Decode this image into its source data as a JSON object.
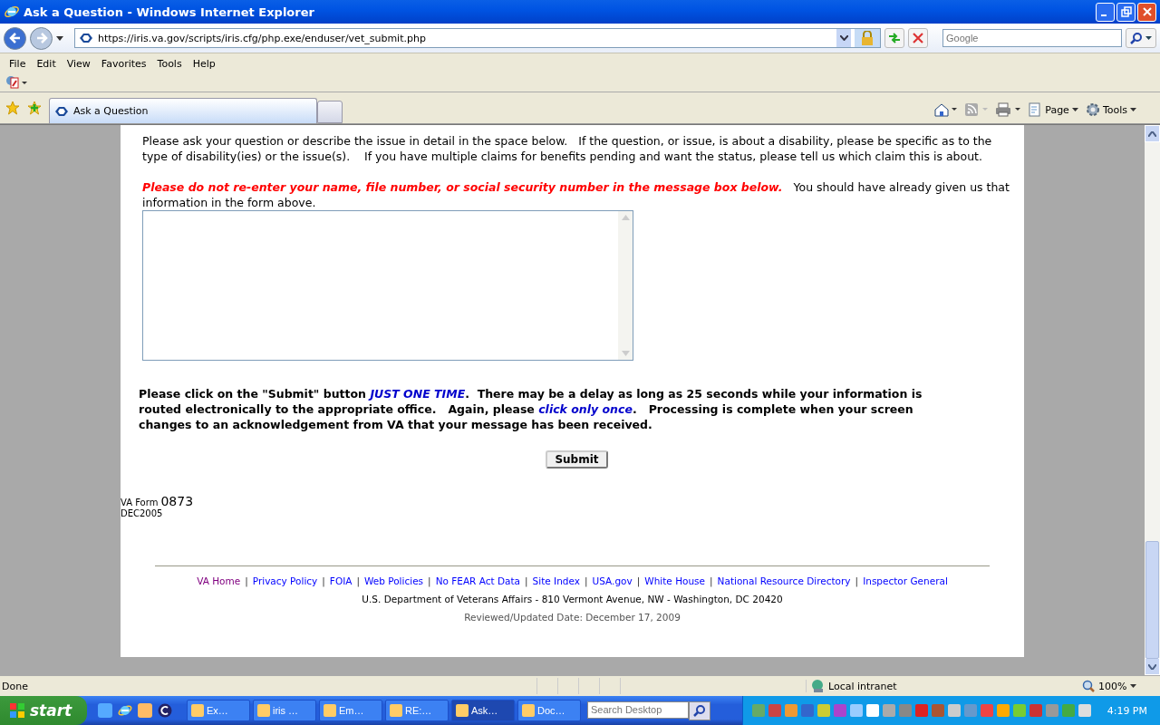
{
  "window": {
    "title": "Ask a Question - Windows Internet Explorer"
  },
  "address_bar": {
    "url": "https://iris.va.gov/scripts/iris.cfg/php.exe/enduser/vet_submit.php"
  },
  "search": {
    "placeholder": "Google"
  },
  "menu": [
    "File",
    "Edit",
    "View",
    "Favorites",
    "Tools",
    "Help"
  ],
  "tabs": [
    {
      "label": "Ask a Question",
      "selected": true
    }
  ],
  "command_bar": {
    "page": "Page",
    "tools": "Tools"
  },
  "page": {
    "intro": "Please ask your question or describe the issue in detail in the space below.   If the question, or issue, is about a disability, please be specific as to the type of disability(ies) or the issue(s).    If you have multiple claims for benefits pending and want the status, please tell us which claim this is about.",
    "warning": "*Please do not re-enter your name, file number, or social security number in the message box below.*   You should have already given us that information in the form above.",
    "notice": "Please click on the \"Submit\" button *JUST ONE TIME*.  There may be a delay as long as 25 seconds while your information is routed electronically to the appropriate office.   Again, please *click only once*.   Processing is complete when your screen changes to an acknowledgement from VA that your message has been received.",
    "submit": "Submit",
    "form_label": "VA Form",
    "form_number": "0873",
    "form_date": "DEC2005",
    "footer_links": [
      {
        "label": "VA Home",
        "visited": true
      },
      {
        "label": "Privacy Policy",
        "visited": false
      },
      {
        "label": "FOIA",
        "visited": false
      },
      {
        "label": "Web Policies",
        "visited": false
      },
      {
        "label": "No FEAR Act Data",
        "visited": false
      },
      {
        "label": "Site Index",
        "visited": false
      },
      {
        "label": "USA.gov",
        "visited": false
      },
      {
        "label": "White House",
        "visited": false
      },
      {
        "label": "National Resource Directory",
        "visited": false
      },
      {
        "label": "Inspector General",
        "visited": false
      }
    ],
    "separator": "|",
    "address": "U.S. Department of Veterans Affairs - 810 Vermont Avenue, NW - Washington, DC 20420",
    "updated": "Reviewed/Updated Date: December 17, 2009"
  },
  "status_bar": {
    "text": "Done",
    "zone": "Local intranet",
    "zoom": "100%"
  },
  "taskbar": {
    "start": "start",
    "buttons": [
      {
        "label": "Ex…",
        "selected": false
      },
      {
        "label": "iris …",
        "selected": false
      },
      {
        "label": "Em…",
        "selected": false
      },
      {
        "label": "RE:…",
        "selected": false
      },
      {
        "label": "Ask…",
        "selected": true
      },
      {
        "label": "Doc…",
        "selected": false
      }
    ],
    "search_placeholder": "Search Desktop",
    "clock": "4:19 PM"
  }
}
